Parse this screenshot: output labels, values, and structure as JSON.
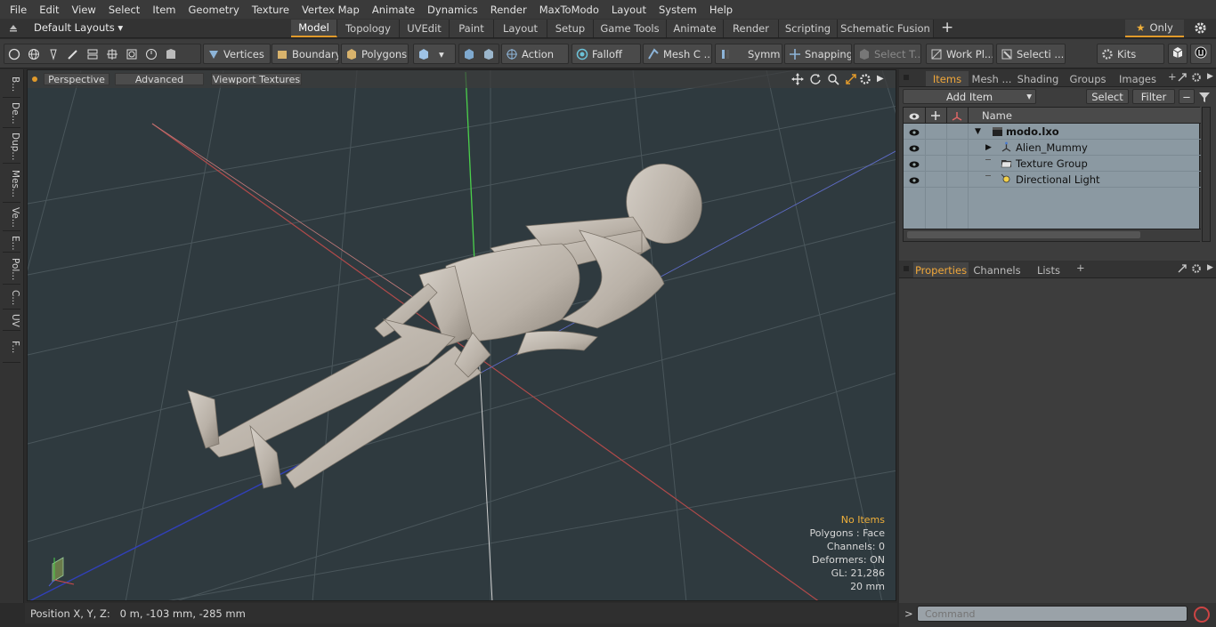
{
  "menu": [
    "File",
    "Edit",
    "View",
    "Select",
    "Item",
    "Geometry",
    "Texture",
    "Vertex Map",
    "Animate",
    "Dynamics",
    "Render",
    "MaxToModo",
    "Layout",
    "System",
    "Help"
  ],
  "layout_bar": {
    "layouts_dropdown": "Default Layouts",
    "tabs": [
      "Model",
      "Topology",
      "UVEdit",
      "Paint",
      "Layout",
      "Setup",
      "Game Tools",
      "Animate",
      "Render",
      "Scripting",
      "Schematic Fusion"
    ],
    "active_tab": "Model",
    "add_tab": "+",
    "only_label": "Only",
    "star": "★"
  },
  "toolbar": {
    "vertices": "Vertices",
    "boundary": "Boundary",
    "polygons": "Polygons",
    "action": "Action",
    "falloff": "Falloff",
    "mesh": "Mesh C ...",
    "symmetry": "Symm ...",
    "snapping": "Snapping",
    "select_t": "Select T...",
    "work_plane": "Work Pl...",
    "selection": "Selecti ...",
    "kits": "Kits"
  },
  "left_strip": [
    "B...",
    "De...",
    "Dup...",
    "Mes...",
    "Ve...",
    "E...",
    "Pol...",
    "C...",
    "UV",
    "F..."
  ],
  "viewport": {
    "perspective": "Perspective",
    "advanced": "Advanced",
    "viewport_textures": "Viewport Textures",
    "info": {
      "no_items": "No Items",
      "polygons": "Polygons : Face",
      "channels": "Channels: 0",
      "deformers": "Deformers: ON",
      "gl": "GL: 21,286",
      "scale": "20 mm"
    }
  },
  "status": {
    "position": "Position X, Y, Z:   0 m, -103 mm, -285 mm"
  },
  "items_panel": {
    "tabs": [
      "Items",
      "Mesh ...",
      "Shading",
      "Groups",
      "Images"
    ],
    "active_tab": "Items",
    "add_item": "Add Item",
    "select": "Select",
    "filter": "Filter",
    "name_header": "Name",
    "tree": [
      {
        "label": "modo.lxo",
        "depth": 0,
        "bold": true,
        "expander": "▼"
      },
      {
        "label": "Alien_Mummy",
        "depth": 1,
        "bold": false,
        "expander": "▶"
      },
      {
        "label": "Texture Group",
        "depth": 1,
        "bold": false,
        "expander": ""
      },
      {
        "label": "Directional Light",
        "depth": 1,
        "bold": false,
        "expander": ""
      }
    ]
  },
  "properties_panel": {
    "tabs": [
      "Properties",
      "Channels",
      "Lists"
    ],
    "active_tab": "Properties"
  },
  "command": {
    "placeholder": "Command",
    "prompt": ">"
  },
  "colors": {
    "accent": "#e19a2b",
    "viewport_bg": "#2f3a3f",
    "tree_bg": "#8b99a2"
  }
}
